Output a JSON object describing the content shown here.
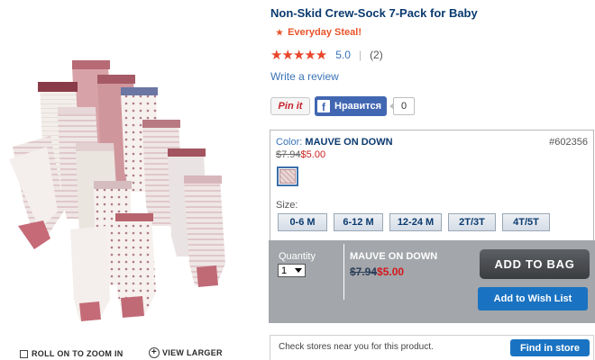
{
  "product": {
    "title": "Non-Skid Crew-Sock 7-Pack for Baby",
    "promo_label": "Everyday Steal!",
    "rating_stars": "★★★★★",
    "rating_value": 5.0,
    "rating_score": "5.0",
    "rating_separator": "|",
    "review_count": "(2)",
    "write_review": "Write a review"
  },
  "social": {
    "pinit_label": "Pin it",
    "facebook_glyph": "f",
    "facebook_like_label": "Нравится",
    "facebook_count": "0"
  },
  "options": {
    "color_prefix": "Color:",
    "color_name": "MAUVE ON DOWN",
    "sku": "#602356",
    "price_old": "$7.94",
    "price_new": "$5.00",
    "swatch_color": "#d8b8ba",
    "size_label": "Size:",
    "sizes": [
      "0-6 M",
      "6-12 M",
      "12-24 M",
      "2T/3T",
      "4T/5T"
    ]
  },
  "purchase": {
    "quantity_label": "Quantity",
    "quantity_value": "1",
    "selected_color": "MAUVE ON DOWN",
    "price_old": "$7.94",
    "price_new": "$5.00",
    "add_to_bag": "ADD TO BAG",
    "add_to_wishlist": "Add to Wish List"
  },
  "stores": {
    "prompt": "Check stores near you for this product.",
    "find_button": "Find in store"
  },
  "image_tools": {
    "zoom_label": "ROLL ON TO ZOOM IN",
    "view_larger_label": "VIEW LARGER"
  },
  "colors": {
    "title_blue": "#0a3a6f",
    "link_blue": "#3a74b8",
    "sale_red": "#c81e1e",
    "promo_orange": "#e8542a",
    "button_blue": "#1a73c2",
    "bag_button": "#4a4c4f",
    "purchase_panel": "#a3a6aa"
  }
}
